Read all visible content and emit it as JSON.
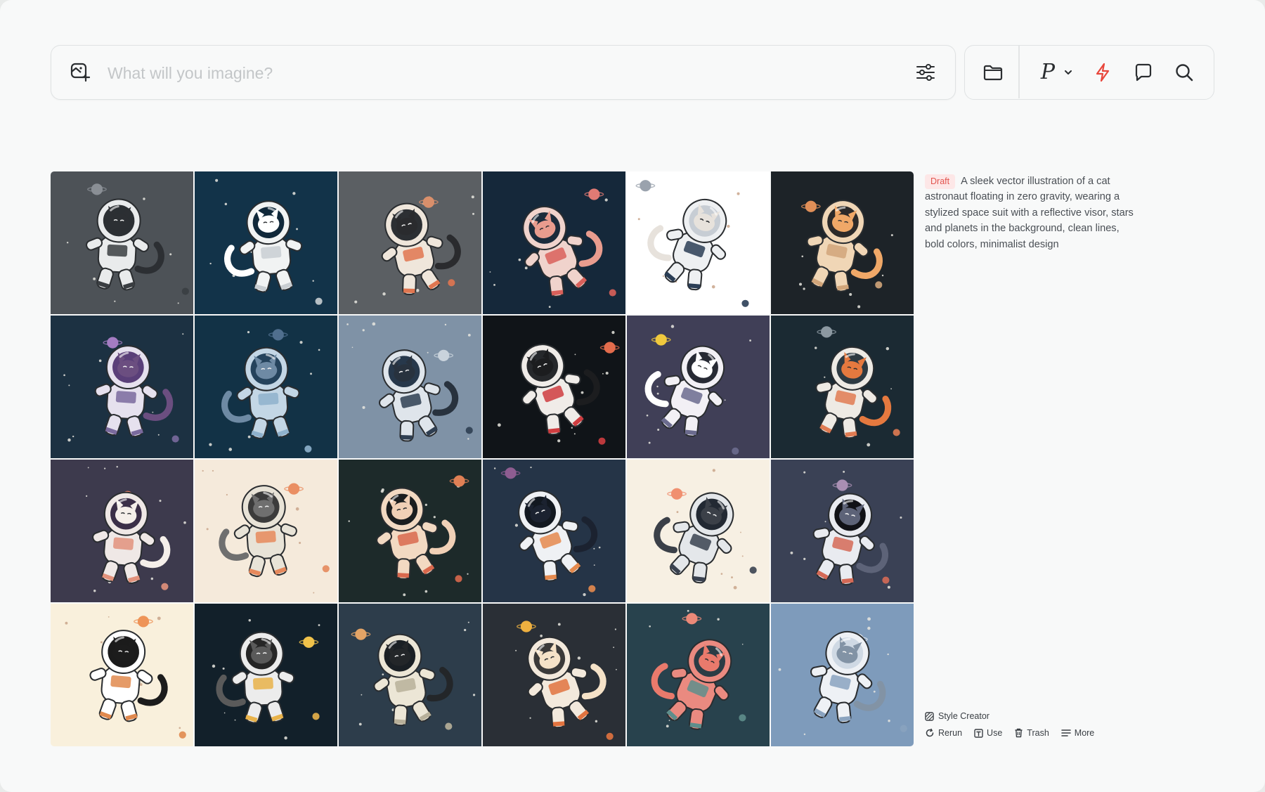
{
  "prompt_bar": {
    "placeholder": "What will you imagine?",
    "value": ""
  },
  "toolbar": {
    "model_letter": "P",
    "accent_color": "#e8473c"
  },
  "results": {
    "badge": "Draft",
    "prompt": "A sleek vector illustration of a cat astronaut floating in zero gravity, wearing a stylized space suit with a reflective visor, stars and planets in the background, clean lines, bold colors, minimalist design",
    "tile_count": 24
  },
  "actions": {
    "style_creator": "Style Creator",
    "rerun": "Rerun",
    "use": "Use",
    "trash": "Trash",
    "more": "More"
  },
  "tiles": [
    {
      "bg": "#4d5257",
      "suit": "#e9ebec",
      "accent": "#3a3e42",
      "visor": "#2b2f33",
      "planet": "#8a8f95",
      "fur": "#2c2f33"
    },
    {
      "bg": "#123349",
      "suit": "#f1f3f3",
      "accent": "#c9ced2",
      "visor": "#10283a",
      "planet": "#e7856a",
      "fur": "#ffffff"
    },
    {
      "bg": "#5b5f63",
      "suit": "#efe6db",
      "accent": "#e07650",
      "visor": "#2c2f33",
      "planet": "#d98f6b",
      "fur": "#2a2b2e"
    },
    {
      "bg": "#15283a",
      "suit": "#f0d3cc",
      "accent": "#d9605a",
      "visor": "#1b2b3b",
      "planet": "#e07a74",
      "fur": "#e99c8e"
    },
    {
      "bg": "#ffffff",
      "suit": "#eef0f2",
      "accent": "#2a3d55",
      "visor": "#c7cdd4",
      "planet": "#9aa2ad",
      "fur": "#e7e2dc"
    },
    {
      "bg": "#1d2328",
      "suit": "#f0d6b6",
      "accent": "#d1a57a",
      "visor": "#2c2a2a",
      "planet": "#e08f58",
      "fur": "#f0a868"
    },
    {
      "bg": "#1c3142",
      "suit": "#e6e1ee",
      "accent": "#7a6a9d",
      "visor": "#5a3f79",
      "planet": "#a47cc2",
      "fur": "#6b4e80"
    },
    {
      "bg": "#123246",
      "suit": "#c3d6e5",
      "accent": "#8fb1cc",
      "visor": "#25435c",
      "planet": "#506f8e",
      "fur": "#6e8aa4"
    },
    {
      "bg": "#7f92a6",
      "suit": "#dfe5eb",
      "accent": "#2f3f52",
      "visor": "#27384b",
      "planet": "#c9d3dc",
      "fur": "#28323e"
    },
    {
      "bg": "#101418",
      "suit": "#f0ece8",
      "accent": "#cf3d40",
      "visor": "#26282b",
      "planet": "#e36c4c",
      "fur": "#1c1d1f"
    },
    {
      "bg": "#403f57",
      "suit": "#f2f0f5",
      "accent": "#6b6b8e",
      "visor": "#272a34",
      "planet": "#f0c93d",
      "fur": "#ffffff"
    },
    {
      "bg": "#1b2a33",
      "suit": "#eeeae4",
      "accent": "#e07b52",
      "visor": "#2e3a42",
      "planet": "#8c98a1",
      "fur": "#e5793f"
    },
    {
      "bg": "#3d3a4d",
      "suit": "#efe8e6",
      "accent": "#e2927c",
      "visor": "#3b2f48",
      "planet": "#e27d63",
      "fur": "#f5efea"
    },
    {
      "bg": "#f5eadb",
      "suit": "#e8e3d7",
      "accent": "#e6895c",
      "visor": "#3b3b3b",
      "planet": "#ea8f63",
      "fur": "#6f6f6f"
    },
    {
      "bg": "#1d2a2a",
      "suit": "#f2d9c2",
      "accent": "#d9684d",
      "visor": "#1a1d1f",
      "planet": "#e08055",
      "fur": "#f0d0b6"
    },
    {
      "bg": "#253447",
      "suit": "#eff1f4",
      "accent": "#e58a4e",
      "visor": "#121820",
      "planet": "#8e5d91",
      "fur": "#1b2230"
    },
    {
      "bg": "#f7f0e3",
      "suit": "#e4e7ea",
      "accent": "#3a4250",
      "visor": "#222933",
      "planet": "#f09070",
      "fur": "#3b4048"
    },
    {
      "bg": "#3a4155",
      "suit": "#e9ebf0",
      "accent": "#d56a57",
      "visor": "#111217",
      "planet": "#a98fb3",
      "fur": "#5d6378"
    },
    {
      "bg": "#f9f0dc",
      "suit": "#ffffff",
      "accent": "#e0894e",
      "visor": "#1b1b1b",
      "planet": "#ee9458",
      "fur": "#1c1c1c"
    },
    {
      "bg": "#12202a",
      "suit": "#ececec",
      "accent": "#e9b34a",
      "visor": "#262626",
      "planet": "#f0c24a",
      "fur": "#5a5a5a"
    },
    {
      "bg": "#2d3d4b",
      "suit": "#ece6d6",
      "accent": "#b8b09a",
      "visor": "#1a1f24",
      "planet": "#e4a466",
      "fur": "#232629"
    },
    {
      "bg": "#2a2f36",
      "suit": "#f3e9dc",
      "accent": "#e1733f",
      "visor": "#3b3a3a",
      "planet": "#eeb040",
      "fur": "#f5e2c8"
    },
    {
      "bg": "#28424d",
      "suit": "#ea8a80",
      "accent": "#5e8e8c",
      "visor": "#2b3c45",
      "planet": "#ec8978",
      "fur": "#e97a6c"
    },
    {
      "bg": "#7e9bbb",
      "suit": "#eef1f5",
      "accent": "#8aa3bf",
      "visor": "#cfd9e4",
      "planet": "#e6ebf2",
      "fur": "#8293a5"
    }
  ]
}
